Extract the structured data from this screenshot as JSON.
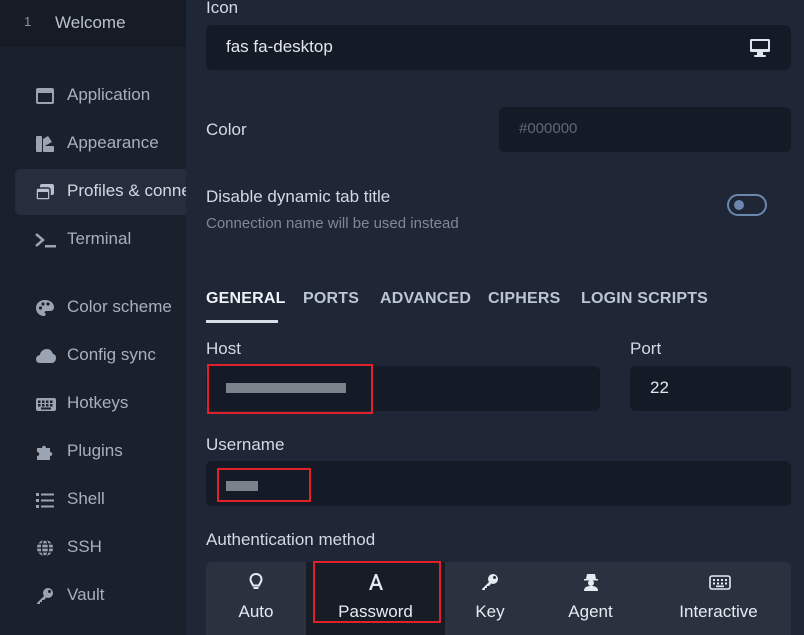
{
  "sidebar": {
    "welcome": {
      "number": "1",
      "label": "Welcome"
    },
    "items": [
      {
        "label": "Application",
        "icon": "window-icon"
      },
      {
        "label": "Appearance",
        "icon": "palette-swatch-icon"
      },
      {
        "label": "Profiles & connections",
        "icon": "windows-stack-icon",
        "active": true
      },
      {
        "label": "Terminal",
        "icon": "terminal-prompt-icon"
      },
      {
        "label": "Color scheme",
        "icon": "palette-icon"
      },
      {
        "label": "Config sync",
        "icon": "cloud-icon"
      },
      {
        "label": "Hotkeys",
        "icon": "keyboard-icon"
      },
      {
        "label": "Plugins",
        "icon": "puzzle-icon"
      },
      {
        "label": "Shell",
        "icon": "list-icon"
      },
      {
        "label": "SSH",
        "icon": "globe-icon"
      },
      {
        "label": "Vault",
        "icon": "key-icon"
      }
    ]
  },
  "form": {
    "icon_label": "Icon",
    "icon_value": "fas fa-desktop",
    "color_label": "Color",
    "color_placeholder": "#000000",
    "dynamic_title_label": "Disable dynamic tab title",
    "dynamic_title_hint": "Connection name will be used instead",
    "tabs": [
      "GENERAL",
      "PORTS",
      "ADVANCED",
      "CIPHERS",
      "LOGIN SCRIPTS"
    ],
    "host_label": "Host",
    "port_label": "Port",
    "port_value": "22",
    "username_label": "Username",
    "auth_label": "Authentication method",
    "auth_methods": [
      {
        "label": "Auto",
        "icon": "lightbulb-icon"
      },
      {
        "label": "Password",
        "icon": "font-a-icon",
        "active": true
      },
      {
        "label": "Key",
        "icon": "key-icon"
      },
      {
        "label": "Agent",
        "icon": "user-secret-icon"
      },
      {
        "label": "Interactive",
        "icon": "keyboard-icon"
      }
    ]
  },
  "colors": {
    "background": "#1f2635",
    "sidebar": "#1a202c",
    "input": "#151b26",
    "highlight": "#e0202b",
    "toggle": "#6a88ad"
  }
}
